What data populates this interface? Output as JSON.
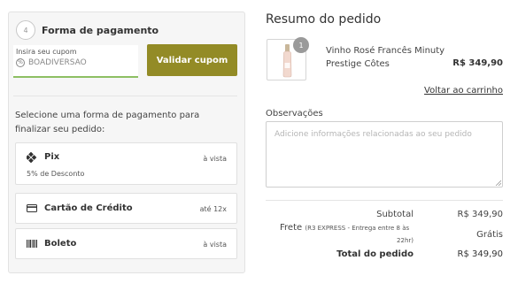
{
  "payment": {
    "step_number": "4",
    "title": "Forma de pagamento",
    "coupon": {
      "label": "Insira seu cupom",
      "value": "BOADIVERSAO",
      "button": "Validar cupom"
    },
    "instruction": "Selecione uma forma de pagamento para finalizar seu pedido:",
    "methods": [
      {
        "name": "Pix",
        "sub": "5% de Desconto",
        "term": "à vista",
        "icon": "pix-icon"
      },
      {
        "name": "Cartão de Crédito",
        "term": "até 12x",
        "icon": "credit-card-icon"
      },
      {
        "name": "Boleto",
        "term": "à vista",
        "icon": "barcode-icon"
      }
    ]
  },
  "summary": {
    "title": "Resumo do pedido",
    "product": {
      "quantity": "1",
      "name": "Vinho Rosé Francês Minuty Prestige Côtes",
      "price": "R$ 349,90"
    },
    "back_link": "Voltar ao carrinho",
    "observations": {
      "label": "Observações",
      "placeholder": "Adicione informações relacionadas ao seu pedido"
    },
    "totals": {
      "subtotal_label": "Subtotal",
      "subtotal_value": "R$ 349,90",
      "frete_label": "Frete",
      "frete_note_1": "(R3 EXPRESS - Entrega entre 8 às",
      "frete_note_2": "22hr)",
      "frete_value": "Grátis",
      "total_label": "Total do pedido",
      "total_value": "R$ 349,90"
    }
  },
  "colors": {
    "accent_button": "#938b26",
    "coupon_underline": "#8dbf63",
    "panel_bg": "#f6f6f6"
  }
}
